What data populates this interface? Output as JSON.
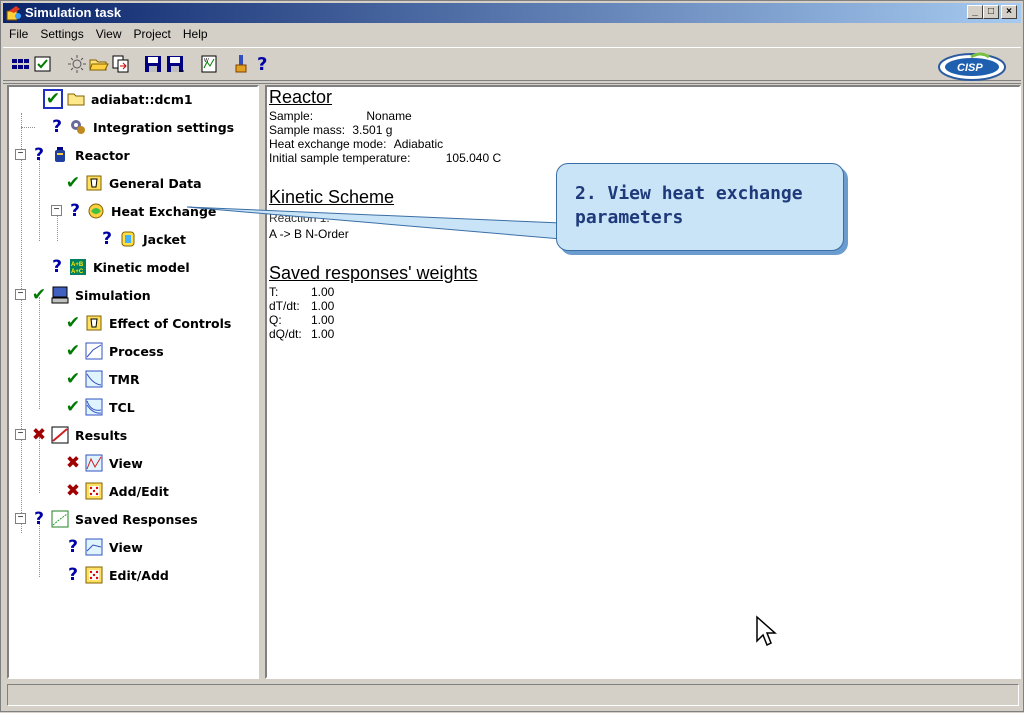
{
  "window": {
    "title": "Simulation task",
    "controls": {
      "minimize": "_",
      "maximize": "□",
      "close": "×"
    }
  },
  "menu": [
    "File",
    "Settings",
    "View",
    "Project",
    "Help"
  ],
  "toolbar_icons": [
    "grid-icon",
    "checklist-icon",
    "sun-icon",
    "folder-open-icon",
    "copy-icon",
    "save-icon",
    "save-as-icon",
    "report-icon",
    "flask-icon",
    "help-icon"
  ],
  "toolbar_help": "?",
  "logo_text": "CISP",
  "tree": {
    "root": "adiabat::dcm1",
    "integration_settings": "Integration settings",
    "reactor": "Reactor",
    "general_data": "General Data",
    "heat_exchange": "Heat Exchange",
    "jacket": "Jacket",
    "kinetic_model": "Kinetic model",
    "simulation": "Simulation",
    "effect_of_controls": "Effect of Controls",
    "process": "Process",
    "tmr": "TMR",
    "tcl": "TCL",
    "results": "Results",
    "results_view": "View",
    "results_add_edit": "Add/Edit",
    "saved_responses": "Saved Responses",
    "saved_view": "View",
    "saved_edit_add": "Edit/Add"
  },
  "marks": {
    "q": "?",
    "check": "✔",
    "x": "✖",
    "minus": "−"
  },
  "content": {
    "reactor_title": "Reactor",
    "sample_label": "Sample:",
    "sample_value": "Noname",
    "mass_label": "Sample mass:",
    "mass_value": "3.501 g",
    "hx_label": "Heat exchange mode:",
    "hx_value": "Adiabatic",
    "temp_label": "Initial sample temperature:",
    "temp_value": "105.040 C",
    "kinetic_title": "Kinetic Scheme",
    "reaction_label": "Reaction 1:",
    "reaction_value": "A -> B  N-Order",
    "weights_title": "Saved responses' weights",
    "weights": [
      {
        "label": "T:",
        "value": "1.00"
      },
      {
        "label": "dT/dt:",
        "value": "1.00"
      },
      {
        "label": "Q:",
        "value": "1.00"
      },
      {
        "label": "dQ/dt:",
        "value": "1.00"
      }
    ]
  },
  "callout": "2. View heat exchange parameters"
}
